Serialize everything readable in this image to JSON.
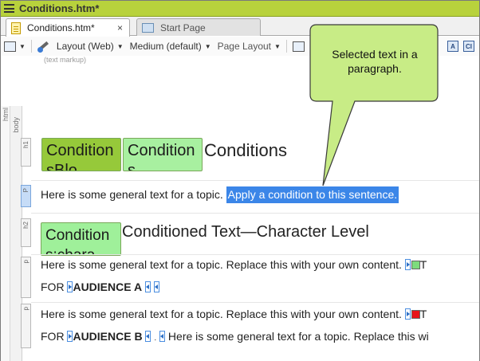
{
  "window": {
    "title": "Conditions.htm*"
  },
  "tabs": [
    {
      "label": "Conditions.htm*",
      "active": true,
      "close": "×"
    },
    {
      "label": "Start Page",
      "active": false
    }
  ],
  "toolbar": {
    "layout": "Layout (Web)",
    "medium": "Medium (default)",
    "page_layout": "Page Layout",
    "markup_caption": "(text markup)",
    "icon_a": "A",
    "icon_b": "CI"
  },
  "structure_bar": {
    "html": "html",
    "body": "body"
  },
  "tags": {
    "h1": "h1",
    "p": "P",
    "h2": "h2",
    "p_small": "p"
  },
  "content": {
    "h1_cond_dark": "ConditionsBlo",
    "h1_cond_light": "Conditions",
    "h1_text": "Conditions",
    "p1_plain": "Here is some general text for a topic. ",
    "p1_selected": "Apply a condition to this sentence.",
    "h2_cond": "Condition s:chara",
    "h2_text": "Conditioned Text—Character Level",
    "p2_line1": "Here is some general text for a topic. Replace this with your own content. ",
    "p2_trail": "T",
    "p2_line2_pre": "FOR ",
    "p2_line2_bold": "AUDIENCE A",
    "p3_line1": "Here is some general text for a topic. Replace this with your own content. ",
    "p3_trail": "T",
    "p3_line2_pre": "FOR ",
    "p3_line2_bold": "AUDIENCE B",
    "p3_line2_post": " Here is some general text for a topic. Replace this wi"
  },
  "callout": {
    "text": "Selected text in a paragraph."
  },
  "colors": {
    "titlebar": "#b8d23c",
    "selection": "#3b86e8",
    "callout_fill": "#c8ec86",
    "cond_dark": "#96c93a",
    "cond_light": "#a8f0a0",
    "swatch_green": "#7ddc7d",
    "swatch_red": "#e8141b"
  }
}
